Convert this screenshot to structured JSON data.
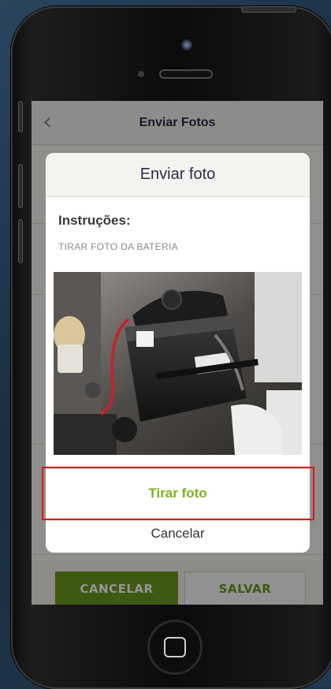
{
  "nav": {
    "title": "Enviar Fotos"
  },
  "buttons": {
    "cancel_label": "CANCELAR",
    "save_label": "SALVAR"
  },
  "modal": {
    "title": "Enviar foto",
    "instructions_label": "Instruções:",
    "instructions_text": "TIRAR FOTO DA BATERIA",
    "take_photo_label": "Tirar foto",
    "cancel_label": "Cancelar"
  },
  "colors": {
    "accent_green": "#7fae1e",
    "button_green": "#6c9a20",
    "title_navy": "#2f2a4a",
    "highlight_red": "#e0151b"
  },
  "icons": {
    "back": "chevron-left-icon",
    "home": "home-button-icon"
  }
}
